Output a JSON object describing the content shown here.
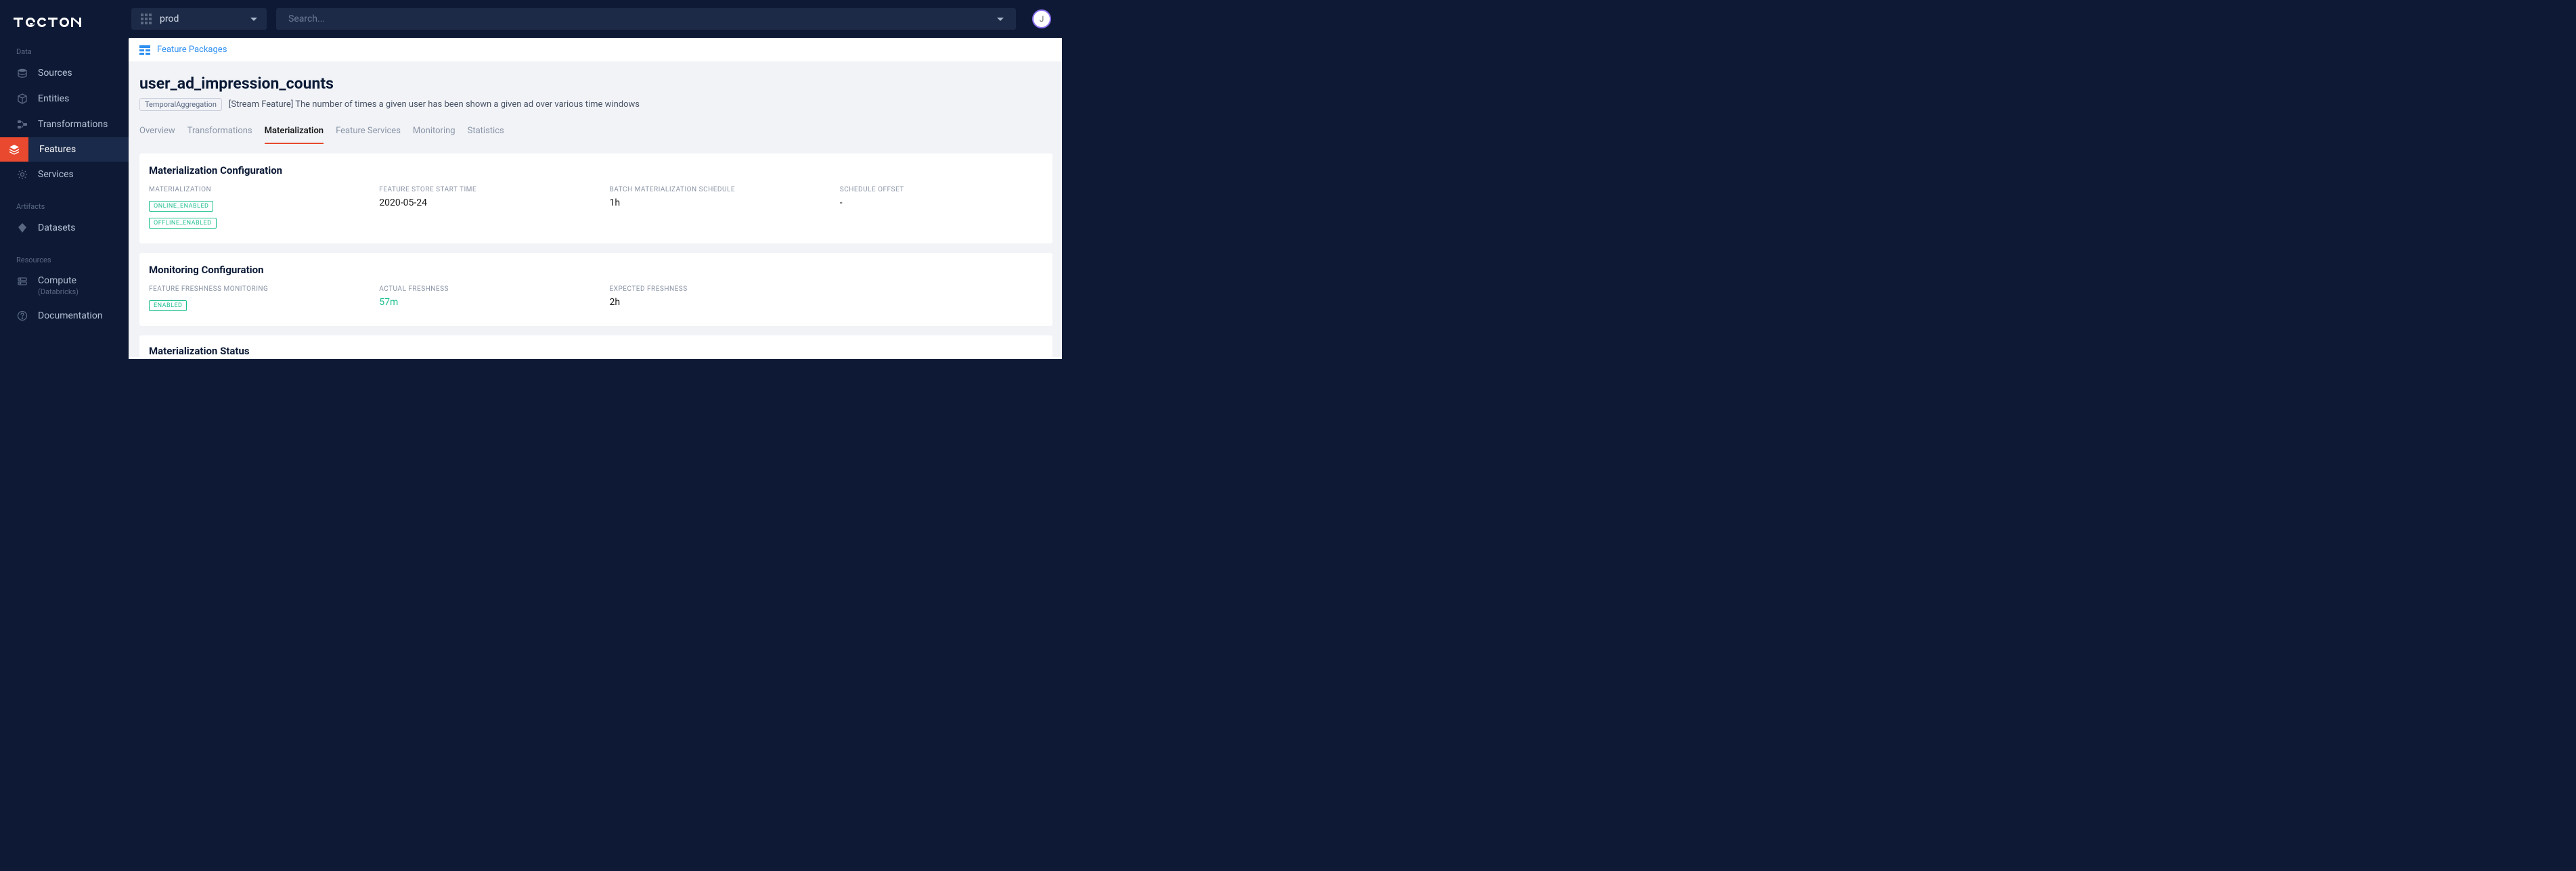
{
  "workspace": {
    "name": "prod"
  },
  "search": {
    "placeholder": "Search..."
  },
  "avatar": {
    "initial": "J"
  },
  "sidebar": {
    "sections": {
      "data": {
        "title": "Data",
        "items": [
          {
            "label": "Sources"
          },
          {
            "label": "Entities"
          },
          {
            "label": "Transformations"
          },
          {
            "label": "Features"
          },
          {
            "label": "Services"
          }
        ]
      },
      "artifacts": {
        "title": "Artifacts",
        "items": [
          {
            "label": "Datasets"
          }
        ]
      },
      "resources": {
        "title": "Resources",
        "items": [
          {
            "label": "Compute",
            "sublabel": "(Databricks)"
          },
          {
            "label": "Documentation"
          }
        ]
      }
    }
  },
  "breadcrumb": {
    "link": "Feature Packages"
  },
  "page": {
    "title": "user_ad_impression_counts",
    "tag": "TemporalAggregation",
    "description": "[Stream Feature] The number of times a given user has been shown a given ad over various time windows"
  },
  "tabs": [
    {
      "label": "Overview"
    },
    {
      "label": "Transformations"
    },
    {
      "label": "Materialization"
    },
    {
      "label": "Feature Services"
    },
    {
      "label": "Monitoring"
    },
    {
      "label": "Statistics"
    }
  ],
  "materialization": {
    "title": "Materialization Configuration",
    "items": {
      "state": {
        "label": "MATERIALIZATION",
        "badges": [
          "ONLINE_ENABLED",
          "OFFLINE_ENABLED"
        ]
      },
      "start": {
        "label": "FEATURE STORE START TIME",
        "value": "2020-05-24"
      },
      "schedule": {
        "label": "BATCH MATERIALIZATION SCHEDULE",
        "value": "1h"
      },
      "offset": {
        "label": "SCHEDULE OFFSET",
        "value": "-"
      }
    }
  },
  "monitoring": {
    "title": "Monitoring Configuration",
    "items": {
      "freshness": {
        "label": "FEATURE FRESHNESS MONITORING",
        "badge": "ENABLED"
      },
      "actual": {
        "label": "ACTUAL FRESHNESS",
        "value": "57m"
      },
      "expected": {
        "label": "EXPECTED FRESHNESS",
        "value": "2h"
      }
    }
  },
  "status": {
    "title": "Materialization Status"
  }
}
